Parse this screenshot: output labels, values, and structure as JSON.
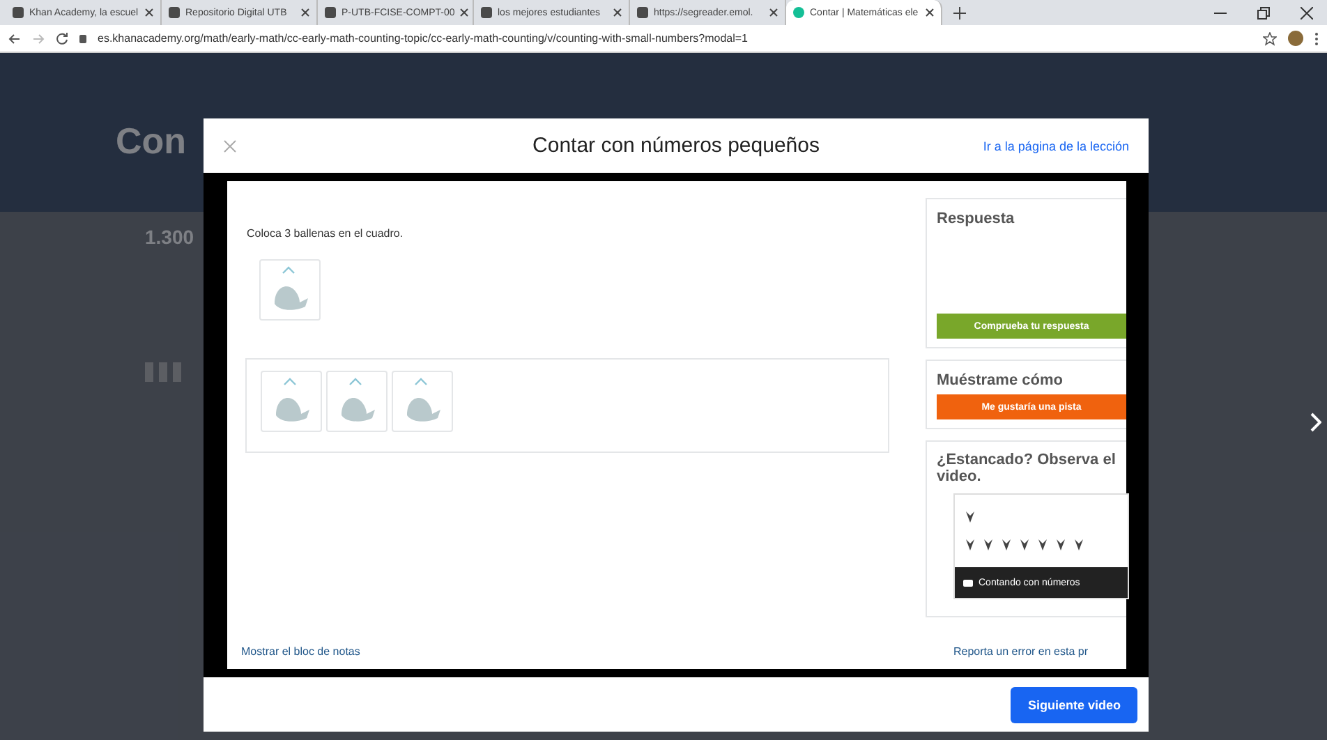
{
  "browser": {
    "tabs": [
      {
        "title": "Khan Academy, la escuel",
        "selected": false
      },
      {
        "title": "Repositorio Digital UTB",
        "selected": false
      },
      {
        "title": "P-UTB-FCISE-COMPT-00",
        "selected": false
      },
      {
        "title": "los mejores estudiantes",
        "selected": false
      },
      {
        "title": "https://segreader.emol.",
        "selected": false
      },
      {
        "title": "Contar | Matemáticas ele",
        "selected": true
      }
    ],
    "address": "es.khanacademy.org/math/early-math/cc-early-math-counting-topic/cc-early-math-counting/v/counting-with-small-numbers?modal=1"
  },
  "background_page": {
    "title": "Con",
    "points": "1.300"
  },
  "modal": {
    "title": "Contar con números pequeños",
    "lesson_link": "Ir a la página de la lección",
    "question": "Coloca 3 ballenas en el cuadro.",
    "source_tiles": [
      {
        "kind": "whale"
      }
    ],
    "drop_tiles": [
      {
        "kind": "whale"
      },
      {
        "kind": "whale"
      },
      {
        "kind": "whale"
      }
    ],
    "scratchpad_link": "Mostrar el bloc de notas",
    "answer": {
      "heading": "Respuesta",
      "button": "Comprueba tu respuesta"
    },
    "hint": {
      "heading": "Muéstrame cómo",
      "button": "Me gustaría una pista"
    },
    "video": {
      "heading": "¿Estancado? Observa el video.",
      "caption": "Contando con números"
    },
    "report_link": "Reporta un error en esta pr",
    "next_button": "Siguiente video"
  }
}
